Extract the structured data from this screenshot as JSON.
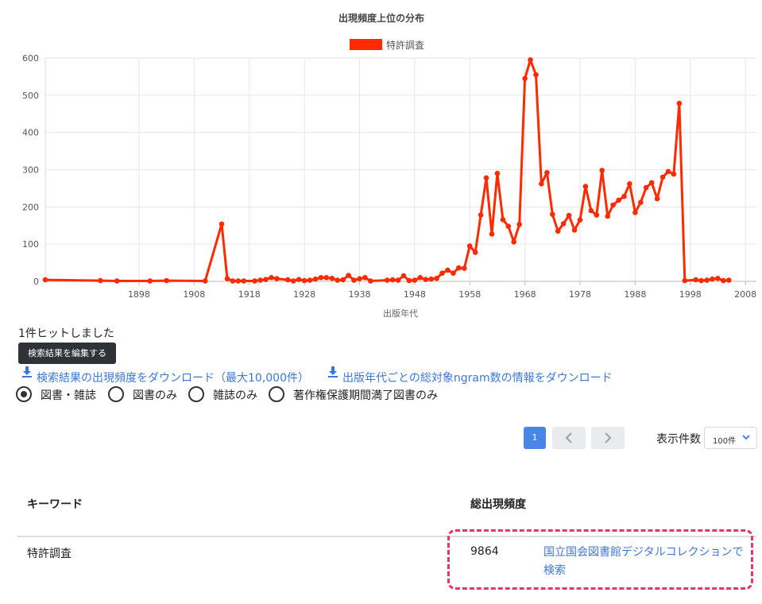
{
  "chart_data": {
    "type": "line",
    "title": "出現頻度上位の分布",
    "xlabel": "出版年代",
    "ylabel": "",
    "xlim": [
      1881,
      2010
    ],
    "ylim": [
      0,
      600
    ],
    "xticks": [
      1898,
      1908,
      1918,
      1928,
      1938,
      1948,
      1958,
      1968,
      1978,
      1988,
      1998,
      2008
    ],
    "yticks": [
      0,
      100,
      200,
      300,
      400,
      500,
      600
    ],
    "grid": true,
    "legend_position": "top",
    "series": [
      {
        "name": "特許調査",
        "color": "#ff2a00",
        "points": [
          [
            1881,
            4
          ],
          [
            1891,
            2
          ],
          [
            1894,
            1
          ],
          [
            1900,
            1
          ],
          [
            1903,
            2
          ],
          [
            1910,
            1
          ],
          [
            1913,
            154
          ],
          [
            1914,
            7
          ],
          [
            1915,
            1
          ],
          [
            1916,
            1
          ],
          [
            1917,
            1
          ],
          [
            1919,
            1
          ],
          [
            1920,
            3
          ],
          [
            1921,
            5
          ],
          [
            1922,
            10
          ],
          [
            1923,
            7
          ],
          [
            1925,
            4
          ],
          [
            1926,
            1
          ],
          [
            1927,
            5
          ],
          [
            1928,
            2
          ],
          [
            1929,
            3
          ],
          [
            1930,
            6
          ],
          [
            1931,
            10
          ],
          [
            1932,
            10
          ],
          [
            1933,
            8
          ],
          [
            1934,
            3
          ],
          [
            1935,
            4
          ],
          [
            1936,
            16
          ],
          [
            1937,
            3
          ],
          [
            1938,
            7
          ],
          [
            1939,
            10
          ],
          [
            1940,
            1
          ],
          [
            1943,
            3
          ],
          [
            1944,
            4
          ],
          [
            1945,
            3
          ],
          [
            1946,
            15
          ],
          [
            1947,
            2
          ],
          [
            1948,
            3
          ],
          [
            1949,
            10
          ],
          [
            1950,
            5
          ],
          [
            1951,
            6
          ],
          [
            1952,
            8
          ],
          [
            1953,
            22
          ],
          [
            1954,
            30
          ],
          [
            1955,
            22
          ],
          [
            1956,
            36
          ],
          [
            1957,
            35
          ],
          [
            1958,
            95
          ],
          [
            1959,
            78
          ],
          [
            1960,
            178
          ],
          [
            1961,
            278
          ],
          [
            1962,
            127
          ],
          [
            1963,
            290
          ],
          [
            1964,
            166
          ],
          [
            1965,
            148
          ],
          [
            1966,
            106
          ],
          [
            1967,
            153
          ],
          [
            1968,
            545
          ],
          [
            1969,
            595
          ],
          [
            1970,
            555
          ],
          [
            1971,
            262
          ],
          [
            1972,
            292
          ],
          [
            1973,
            180
          ],
          [
            1974,
            135
          ],
          [
            1975,
            155
          ],
          [
            1976,
            177
          ],
          [
            1977,
            138
          ],
          [
            1978,
            165
          ],
          [
            1979,
            255
          ],
          [
            1980,
            190
          ],
          [
            1981,
            178
          ],
          [
            1982,
            298
          ],
          [
            1983,
            175
          ],
          [
            1984,
            205
          ],
          [
            1985,
            218
          ],
          [
            1986,
            228
          ],
          [
            1987,
            262
          ],
          [
            1988,
            185
          ],
          [
            1989,
            212
          ],
          [
            1990,
            252
          ],
          [
            1991,
            265
          ],
          [
            1992,
            222
          ],
          [
            1993,
            280
          ],
          [
            1994,
            295
          ],
          [
            1995,
            288
          ],
          [
            1996,
            478
          ],
          [
            1997,
            2
          ],
          [
            1999,
            4
          ],
          [
            2000,
            2
          ],
          [
            2001,
            3
          ],
          [
            2002,
            6
          ],
          [
            2003,
            8
          ],
          [
            2004,
            2
          ],
          [
            2005,
            3
          ]
        ]
      }
    ]
  },
  "results": {
    "hit_text": "1件ヒットしました",
    "edit_button": "検索結果を編集する",
    "download_freq": "検索結果の出現頻度をダウンロード（最大10,000件）",
    "download_ngram": "出版年代ごとの総対象ngram数の情報をダウンロード"
  },
  "filters": {
    "options": [
      "図書・雑誌",
      "図書のみ",
      "雑誌のみ",
      "著作権保護期間満了図書のみ"
    ],
    "selected": "図書・雑誌"
  },
  "pagination": {
    "current_page": "1",
    "per_page_label": "表示件数",
    "per_page_value": "100件"
  },
  "table": {
    "columns": [
      "キーワード",
      "総出現頻度",
      ""
    ],
    "rows": [
      {
        "keyword": "特許調査",
        "total": "9864",
        "link": "国立国会図書館デジタルコレクションで検索"
      }
    ]
  },
  "colors": {
    "series": "#ff2a00",
    "link": "#3b78d6",
    "pager_active": "#4a86e8",
    "highlight": "#e8336b"
  }
}
